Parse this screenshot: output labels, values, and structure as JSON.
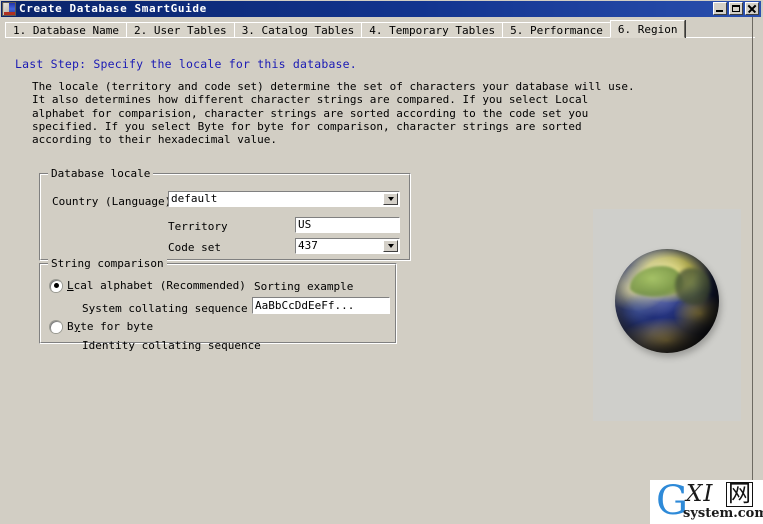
{
  "window": {
    "title": "Create Database SmartGuide",
    "icon": "app-icon",
    "buttons": {
      "minimize": "minimize-button",
      "maximize": "maximize-button",
      "close": "close-button"
    }
  },
  "tabs": [
    {
      "label": "1. Database Name",
      "selected": false
    },
    {
      "label": "2. User Tables",
      "selected": false
    },
    {
      "label": "3. Catalog Tables",
      "selected": false
    },
    {
      "label": "4. Temporary Tables",
      "selected": false
    },
    {
      "label": "5. Performance",
      "selected": false
    },
    {
      "label": "6. Region",
      "selected": true
    }
  ],
  "page": {
    "headline": "Last Step: Specify the locale for this database.",
    "headline_color": "#1a1ab4",
    "description": "The locale (territory and code set) determine the set of characters your database will use.\nIt also determines how different character strings are compared. If you select Local\nalphabet for comparision, character strings are sorted according to the code set you\nspecified. If you select Byte for byte for comparison, character strings are sorted\naccording to their hexadecimal value."
  },
  "database_locale": {
    "group_title": "Database locale",
    "country_label": "Country (Language)",
    "country_value": "default",
    "territory_label": "Territory",
    "territory_value": "US",
    "codeset_label": "Code set",
    "codeset_value": "437"
  },
  "string_comparison": {
    "group_title": "String comparison",
    "option_local": {
      "label_pre": "L",
      "label_underlined": "o",
      "label_post": "cal alphabet (Recommended)",
      "full_label": "Local alphabet (Recommended)",
      "sub_label": "System collating sequence",
      "selected": true
    },
    "option_byte": {
      "label_pre": "B",
      "label_underlined": "y",
      "label_post": "te for byte",
      "full_label": "Byte for byte",
      "sub_label": "Identity collating sequence",
      "selected": false
    },
    "sorting_example_label": "Sorting example",
    "sorting_example_value": "AaBbCcDdEeFf..."
  },
  "illustration": {
    "name": "earth-globe-image",
    "alt": "Earth globe"
  },
  "watermark": {
    "g": "G",
    "xi": "XI",
    "cjk": "网",
    "sub": "system.com"
  },
  "colors": {
    "titlebar_start": "#0a246a",
    "titlebar_end": "#2a4fae",
    "dialog_face": "#d2cec4",
    "headline": "#1a1ab4",
    "watermark_blue": "#2e8ad8"
  }
}
